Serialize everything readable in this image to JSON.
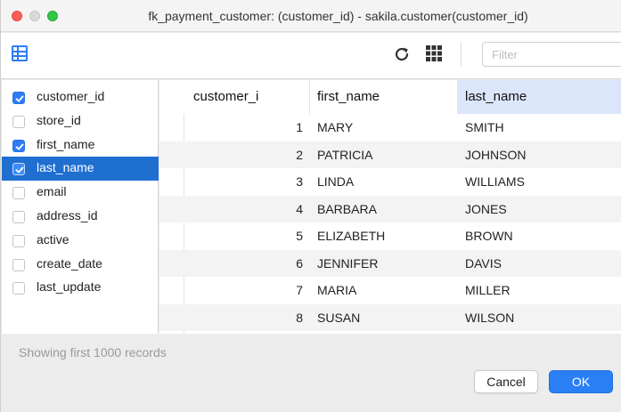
{
  "window": {
    "title": "fk_payment_customer: (customer_id) - sakila.customer(customer_id)"
  },
  "toolbar": {
    "grid_icon": "grid-layout-icon",
    "refresh_icon": "refresh-icon",
    "columns_icon": "columns-grid-icon",
    "filter_placeholder": "Filter",
    "filter_value": ""
  },
  "columns": [
    {
      "label": "customer_id",
      "checked": true,
      "selected": false
    },
    {
      "label": "store_id",
      "checked": false,
      "selected": false
    },
    {
      "label": "first_name",
      "checked": true,
      "selected": false
    },
    {
      "label": "last_name",
      "checked": true,
      "selected": true
    },
    {
      "label": "email",
      "checked": false,
      "selected": false
    },
    {
      "label": "address_id",
      "checked": false,
      "selected": false
    },
    {
      "label": "active",
      "checked": false,
      "selected": false
    },
    {
      "label": "create_date",
      "checked": false,
      "selected": false
    },
    {
      "label": "last_update",
      "checked": false,
      "selected": false
    }
  ],
  "table": {
    "headers": [
      "customer_i",
      "first_name",
      "last_name"
    ],
    "sorted_column": "last_name",
    "rows": [
      [
        "1",
        "MARY",
        "SMITH"
      ],
      [
        "2",
        "PATRICIA",
        "JOHNSON"
      ],
      [
        "3",
        "LINDA",
        "WILLIAMS"
      ],
      [
        "4",
        "BARBARA",
        "JONES"
      ],
      [
        "5",
        "ELIZABETH",
        "BROWN"
      ],
      [
        "6",
        "JENNIFER",
        "DAVIS"
      ],
      [
        "7",
        "MARIA",
        "MILLER"
      ],
      [
        "8",
        "SUSAN",
        "WILSON"
      ]
    ]
  },
  "footer": {
    "status_text": "Showing first 1000 records",
    "cancel_label": "Cancel",
    "ok_label": "OK"
  },
  "colors": {
    "selection": "#1f6fd1",
    "checkbox_on": "#2c7cf6",
    "sorted_header": "#dce6fb",
    "ok_button": "#2a7ff4"
  }
}
